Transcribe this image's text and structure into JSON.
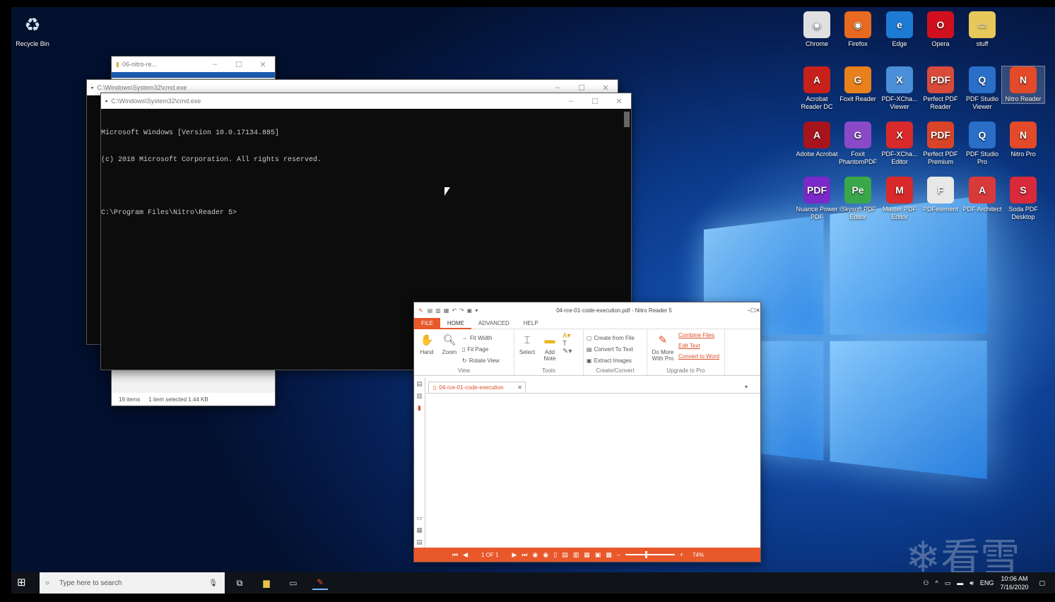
{
  "desktop": {
    "icons_left": [
      {
        "label": "Recycle Bin",
        "icon": "recycle-bin-icon"
      }
    ],
    "icons_right": [
      [
        {
          "label": "Chrome",
          "color": "#e0e0e0",
          "glyph": "◉"
        },
        {
          "label": "Firefox",
          "color": "#e66a1f",
          "glyph": "◉"
        },
        {
          "label": "Edge",
          "color": "#1e7bd4",
          "glyph": "e"
        },
        {
          "label": "Opera",
          "color": "#d0101e",
          "glyph": "O"
        },
        {
          "label": "stuff",
          "color": "#e8c85a",
          "glyph": "▭"
        }
      ],
      [
        {
          "label": "Acrobat Reader DC",
          "color": "#c8211c",
          "glyph": "A"
        },
        {
          "label": "Foxit Reader",
          "color": "#e8801c",
          "glyph": "G"
        },
        {
          "label": "PDF-XCha... Viewer",
          "color": "#4a8fd8",
          "glyph": "X"
        },
        {
          "label": "Perfect PDF Reader",
          "color": "#d84a3a",
          "glyph": "PDF"
        },
        {
          "label": "PDF Studio Viewer",
          "color": "#2a6ec8",
          "glyph": "Q"
        },
        {
          "label": "Nitro Reader",
          "color": "#e24a2a",
          "glyph": "N",
          "selected": true
        }
      ],
      [
        {
          "label": "Adobe Acrobat",
          "color": "#a8141c",
          "glyph": "A"
        },
        {
          "label": "Foxit PhantomPDF",
          "color": "#8a4ac8",
          "glyph": "G"
        },
        {
          "label": "PDF-XCha... Editor",
          "color": "#d82a2a",
          "glyph": "X"
        },
        {
          "label": "Perfect PDF Premium",
          "color": "#d8442a",
          "glyph": "PDF"
        },
        {
          "label": "PDF Studio Pro",
          "color": "#2a6ec8",
          "glyph": "Q"
        },
        {
          "label": "Nitro Pro",
          "color": "#e24a2a",
          "glyph": "N"
        }
      ],
      [
        {
          "label": "Nuance Power PDF",
          "color": "#7a2ac8",
          "glyph": "PDF"
        },
        {
          "label": "iSkysoft PDF Editor",
          "color": "#3aa84a",
          "glyph": "Pe"
        },
        {
          "label": "Master PDF Editor",
          "color": "#d82a2a",
          "glyph": "M"
        },
        {
          "label": "PDFelement",
          "color": "#e8e8e8",
          "glyph": "F"
        },
        {
          "label": "PDF Architect",
          "color": "#d83a3a",
          "glyph": "A"
        },
        {
          "label": "Soda PDF Desktop",
          "color": "#d82a3a",
          "glyph": "S"
        }
      ]
    ]
  },
  "explorer": {
    "title": "06-nitro-re...",
    "status_items": "19 items",
    "status_selected": "1 item selected  1.44 KB"
  },
  "cmd_back": {
    "title": "C:\\Windows\\System32\\cmd.exe"
  },
  "cmd_front": {
    "title": "C:\\Windows\\System32\\cmd.exe",
    "lines": [
      "Microsoft Windows [Version 10.0.17134.885]",
      "(c) 2018 Microsoft Corporation. All rights reserved.",
      "",
      "C:\\Program Files\\Nitro\\Reader 5>"
    ]
  },
  "nitro": {
    "title": "04-rce-01-code-execution.pdf - Nitro Reader 5",
    "tabs": [
      "FILE",
      "HOME",
      "ADVANCED",
      "HELP"
    ],
    "view": {
      "hand": "Hand",
      "zoom": "Zoom",
      "fit_width": "Fit Width",
      "fit_page": "Fit Page",
      "rotate_view": "Rotate View",
      "group": "View"
    },
    "tools": {
      "select": "Select",
      "add_note": "Add Note",
      "group": "Tools"
    },
    "create": {
      "create_from_file": "Create from File",
      "convert_to_text": "Convert To Text",
      "extract_images": "Extract Images",
      "group": "Create/Convert"
    },
    "upgrade": {
      "do_more": "Do More With Pro",
      "combine_files": "Combine Files",
      "edit_text": "Edit Text",
      "convert_to_word": "Convert to Word",
      "group": "Upgrade to Pro"
    },
    "doc_tab": "04-rce-01-code-execution",
    "page_indicator": "1 OF 1",
    "zoom_level": "74%"
  },
  "taskbar": {
    "search_placeholder": "Type here to search",
    "lang": "ENG",
    "time": "10:06 AM",
    "date": "7/16/2020"
  },
  "watermark": "看雪"
}
